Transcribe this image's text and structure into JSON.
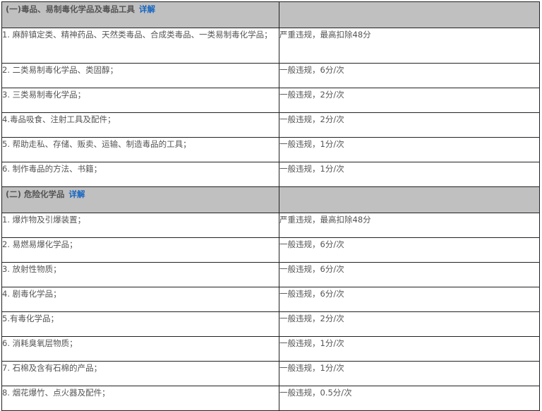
{
  "sections": [
    {
      "title": "(一)毒品、易制毒化学品及毒品工具",
      "link": "详解",
      "rows": [
        {
          "item": "1. 麻醉镇定类、精神药品、天然类毒品、合成类毒品、一类易制毒化学品；",
          "penalty": "严重违规，最高扣除48分"
        },
        {
          "item": "2. 二类易制毒化学品、类固醇；",
          "penalty": "一般违规，6分/次"
        },
        {
          "item": "3. 三类易制毒化学品；",
          "penalty": "一般违规，2分/次"
        },
        {
          "item": "4.毒品吸食、注射工具及配件；",
          "penalty": "一般违规，2分/次"
        },
        {
          "item": "5. 帮助走私、存储、贩卖、运输、制造毒品的工具；",
          "penalty": "一般违规，1分/次"
        },
        {
          "item": "6. 制作毒品的方法、书籍；",
          "penalty": "一般违规，1分/次"
        }
      ]
    },
    {
      "title": "(二) 危险化学品",
      "link": "详解",
      "rows": [
        {
          "item": "1. 爆炸物及引爆装置；",
          "penalty": "严重违规，最高扣除48分"
        },
        {
          "item": "2. 易燃易爆化学品；",
          "penalty": "一般违规，6分/次"
        },
        {
          "item": "3. 放射性物质；",
          "penalty": "一般违规，6分/次"
        },
        {
          "item": "4. 剧毒化学品；",
          "penalty": "一般违规，6分/次"
        },
        {
          "item": "5.有毒化学品；",
          "penalty": "一般违规，2分/次"
        },
        {
          "item": "6. 消耗臭氧层物质；",
          "penalty": "一般违规，1分/次"
        },
        {
          "item": "7. 石棉及含有石棉的产品；",
          "penalty": "一般违规，1分/次"
        },
        {
          "item": "8. 烟花爆竹、点火器及配件；",
          "penalty": "一般违规，0.5分/次"
        }
      ]
    }
  ]
}
